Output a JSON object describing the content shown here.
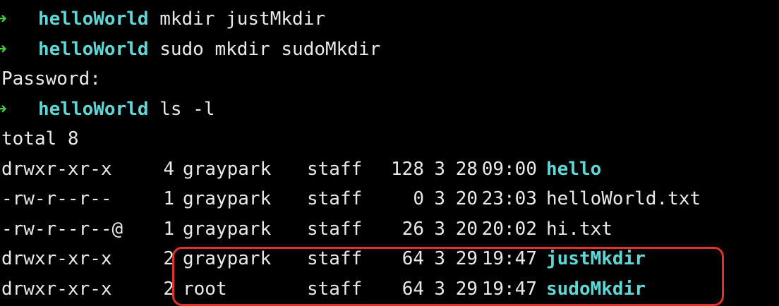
{
  "prompt": {
    "arrow_glyph": "➜",
    "directory": "helloWorld"
  },
  "history": [
    {
      "type": "command",
      "cmd": "mkdir justMkdir"
    },
    {
      "type": "command",
      "cmd": "sudo mkdir sudoMkdir"
    },
    {
      "type": "output",
      "text": "Password:"
    },
    {
      "type": "command",
      "cmd": "ls -l"
    },
    {
      "type": "output",
      "text": "total 8"
    }
  ],
  "listing": [
    {
      "perm": "drwxr-xr-x",
      "links": "4",
      "owner": "graypark",
      "group": "staff",
      "size": "128",
      "month": "3",
      "day": "28",
      "time": "09:00",
      "name": "hello",
      "is_dir": true
    },
    {
      "perm": "-rw-r--r--",
      "links": "1",
      "owner": "graypark",
      "group": "staff",
      "size": "0",
      "month": "3",
      "day": "20",
      "time": "23:03",
      "name": "helloWorld.txt",
      "is_dir": false
    },
    {
      "perm": "-rw-r--r--@",
      "links": "1",
      "owner": "graypark",
      "group": "staff",
      "size": "26",
      "month": "3",
      "day": "20",
      "time": "20:02",
      "name": "hi.txt",
      "is_dir": false
    },
    {
      "perm": "drwxr-xr-x",
      "links": "2",
      "owner": "graypark",
      "group": "staff",
      "size": "64",
      "month": "3",
      "day": "29",
      "time": "19:47",
      "name": "justMkdir",
      "is_dir": true
    },
    {
      "perm": "drwxr-xr-x",
      "links": "2",
      "owner": "root",
      "group": "staff",
      "size": "64",
      "month": "3",
      "day": "29",
      "time": "19:47",
      "name": "sudoMkdir",
      "is_dir": true
    }
  ],
  "colors": {
    "background": "#000000",
    "text": "#e9e9e9",
    "prompt_arrow": "#3fcf3a",
    "directory": "#5fd7d7",
    "highlight_box": "#e0322c"
  }
}
